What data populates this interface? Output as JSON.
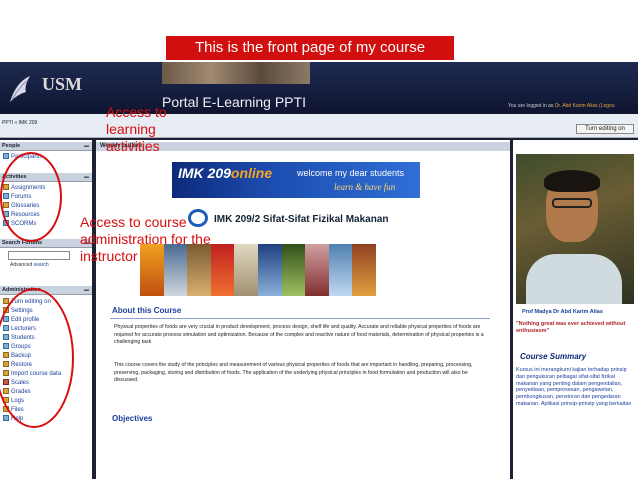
{
  "slide": {
    "banner": "This is the front page of my course"
  },
  "header": {
    "logo_text": "USM",
    "portal_title": "Portal E-Learning PPTI",
    "logged_prefix": "You are logged in as",
    "logged_user": "Dr. Abd Karim Alias",
    "logged_suffix": "(Logou"
  },
  "nav": {
    "breadcrumb": "PPTI » IMK 209",
    "edit_button": "Turn editing on"
  },
  "people": {
    "title": "People",
    "items": [
      "Participants"
    ]
  },
  "activities": {
    "title": "Activities",
    "items": [
      "Assignments",
      "Forums",
      "Glossaries",
      "Resources",
      "SCORMs"
    ]
  },
  "search": {
    "title": "Search Forums",
    "advanced_prefix": "Advanced",
    "advanced_link": "search"
  },
  "admin": {
    "title": "Administration",
    "items": [
      "Turn editing on",
      "Settings",
      "Edit profile",
      "Lecturers",
      "Students",
      "Groups",
      "Backup",
      "Restore",
      "Import course data",
      "Scales",
      "Grades",
      "Logs",
      "Files",
      "Help"
    ]
  },
  "main": {
    "weekly_title": "Weekly outline",
    "banner_course": "IMK 209",
    "banner_online": "online",
    "banner_welcome": "welcome my dear students",
    "banner_tagline": "learn & have fun",
    "subtitle": "IMK 209/2  Sifat-Sifat Fizikal Makanan",
    "about_title": "About this Course",
    "para1": "Physical properties of foods are very crucial in product development, process design, shelf life and quality. Accurate and reliable physical properties of foods are required for accurate process simulation and optimization. Because of the complex and reactive nature of food materials, determination of physical properties is a challenging task",
    "para2": "This course covers the study of the principles and measurement of various physical properties of foods that are important in handling, preparing, processing, preserving, packaging, storing and distribution of foods. The application of the underlying physical principles in food formulation and production will also be discussed.",
    "objectives_title": "Objectives"
  },
  "right": {
    "prof_name": "Prof Madya Dr Abd Karim Alias",
    "quote": "\"Nothing great was ever achieved without enthusiasm\"",
    "summary_title": "Course Summary",
    "summary_text": "Kursus ini merangkumi kajian terhadap prinsip dan pengukuran pelbagai sifat-sifat fizikal makanan yang penting dalam pengendalian, penyediaan, pemprosesan, pengawetan, pembungkusan, penstoran dan pengedaran makanan. Aplikasi prinsip-prinsip yang berkaitan"
  },
  "annotations": {
    "learning": "Access to learning activities",
    "admin": "Access to course administration for the instructor"
  },
  "colors": {
    "annotation": "#d80e0e",
    "banner": "#d10f0f",
    "header": "#0f1530",
    "link": "#1b3f9a"
  }
}
